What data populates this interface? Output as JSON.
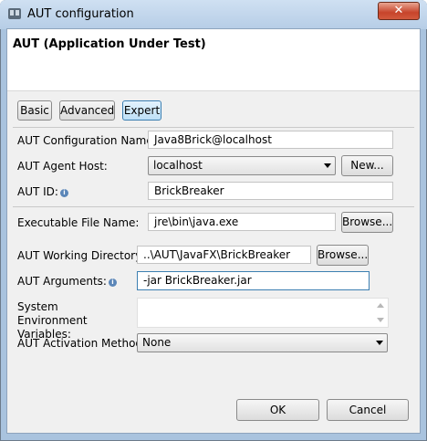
{
  "window": {
    "title": "AUT configuration",
    "close_glyph": "✕"
  },
  "banner": {
    "heading": "AUT (Application Under Test)"
  },
  "mode_tabs": [
    {
      "label": "Basic"
    },
    {
      "label": "Advanced"
    },
    {
      "label": "Expert",
      "active": true
    }
  ],
  "form": {
    "config_name": {
      "label": "AUT Configuration Name:",
      "value": "Java8Brick@localhost"
    },
    "agent_host": {
      "label": "AUT Agent Host:",
      "value": "localhost",
      "new_button": "New..."
    },
    "aut_id": {
      "label": "AUT ID:",
      "value": "BrickBreaker"
    },
    "executable": {
      "label": "Executable File Name:",
      "value": "jre\\bin\\java.exe",
      "browse_button": "Browse..."
    },
    "working_dir": {
      "label": "AUT Working Directory:",
      "value": "..\\AUT\\JavaFX\\BrickBreaker",
      "browse_button": "Browse..."
    },
    "arguments": {
      "label": "AUT Arguments:",
      "value": "-jar BrickBreaker.jar"
    },
    "env_vars": {
      "label": "System Environment Variables:",
      "value": ""
    },
    "activation": {
      "label": "AUT Activation Method:",
      "value": "None"
    }
  },
  "footer": {
    "ok": "OK",
    "cancel": "Cancel"
  },
  "icons": {
    "info": "info-icon",
    "app": "window-app-icon"
  },
  "colors": {
    "accent": "#3c7fb1",
    "close": "#c7442b"
  }
}
